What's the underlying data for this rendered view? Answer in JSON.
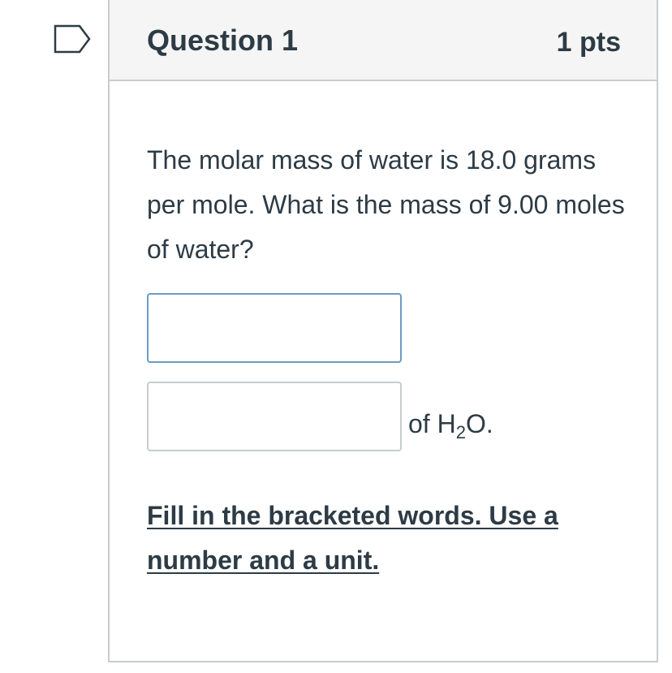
{
  "question": {
    "title": "Question 1",
    "points": "1 pts",
    "text": "The molar mass of water is 18.0 grams per mole. What is the mass of 9.00 moles of water?",
    "answer_fields": [
      {
        "value": "",
        "placeholder": ""
      },
      {
        "value": "",
        "placeholder": ""
      }
    ],
    "suffix_prefix": "of H",
    "suffix_subscript": "2",
    "suffix_end": "O.",
    "instructions": "Fill in the bracketed words. Use a number and a unit."
  },
  "icons": {
    "flag": "flag-question-icon"
  },
  "colors": {
    "text": "#2d3b45",
    "header_bg": "#f5f5f5",
    "border": "#c7cdd1",
    "focus_border": "#6b9bc7"
  }
}
